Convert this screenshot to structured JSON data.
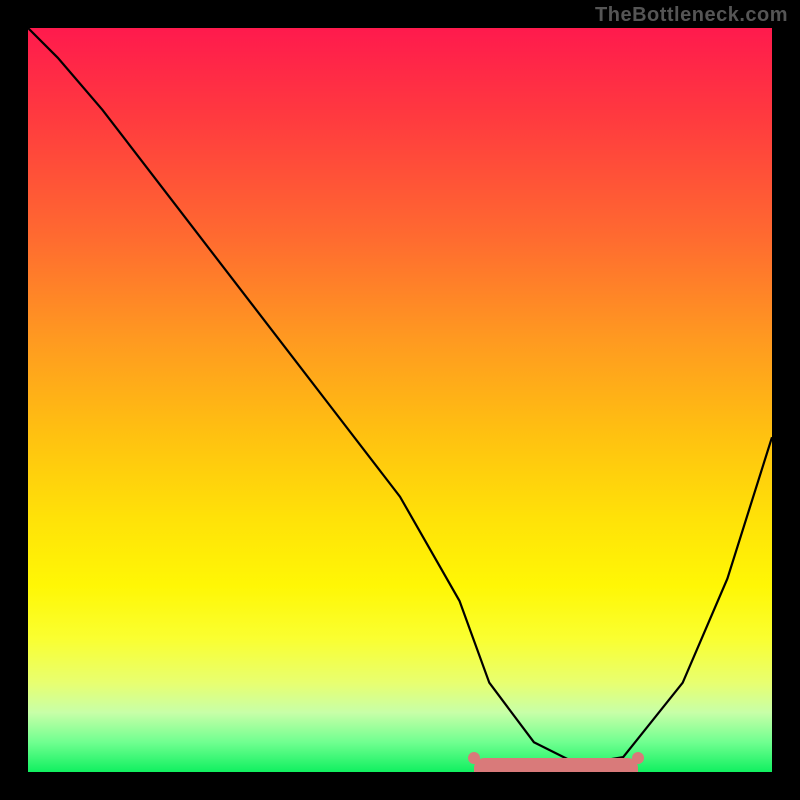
{
  "watermark": "TheBottleneck.com",
  "chart_data": {
    "type": "line",
    "title": "",
    "xlabel": "",
    "ylabel": "",
    "xlim": [
      0,
      100
    ],
    "ylim": [
      0,
      100
    ],
    "grid": false,
    "legend": false,
    "series": [
      {
        "name": "bottleneck-curve",
        "x": [
          0,
          4,
          10,
          20,
          30,
          40,
          50,
          58,
          62,
          68,
          74,
          80,
          88,
          94,
          100
        ],
        "values": [
          100,
          96,
          89,
          76,
          63,
          50,
          37,
          23,
          12,
          4,
          1,
          2,
          12,
          26,
          45
        ]
      }
    ],
    "highlight": {
      "name": "optimal-range",
      "x_start": 60,
      "x_end": 82,
      "color": "#d97a7a"
    },
    "background_gradient": {
      "top": "#ff1a4d",
      "bottom": "#10f060"
    }
  }
}
